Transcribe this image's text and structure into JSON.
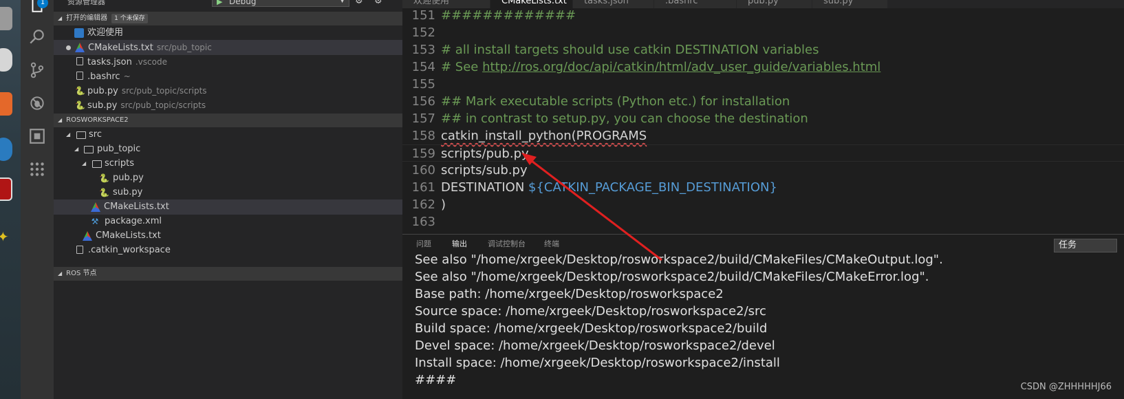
{
  "sidebar": {
    "title": "资源管理器",
    "debug_config": "Debug",
    "open_editors": {
      "header": "打开的编辑器",
      "unsaved_badge": "1 个未保存",
      "items": [
        {
          "label": "欢迎使用",
          "desc": ""
        },
        {
          "label": "CMakeLists.txt",
          "desc": "src/pub_topic"
        },
        {
          "label": "tasks.json",
          "desc": ".vscode"
        },
        {
          "label": ".bashrc",
          "desc": "~"
        },
        {
          "label": "pub.py",
          "desc": "src/pub_topic/scripts"
        },
        {
          "label": "sub.py",
          "desc": "src/pub_topic/scripts"
        }
      ]
    },
    "workspace": {
      "header": "ROSWORKSPACE2",
      "tree": [
        {
          "label": "src"
        },
        {
          "label": "pub_topic"
        },
        {
          "label": "scripts"
        },
        {
          "label": "pub.py"
        },
        {
          "label": "sub.py"
        },
        {
          "label": "CMakeLists.txt"
        },
        {
          "label": "package.xml"
        },
        {
          "label": "CMakeLists.txt"
        },
        {
          "label": ".catkin_workspace"
        }
      ]
    },
    "ros_nodes_header": "ROS 节点"
  },
  "activity": {
    "badge_count": "1"
  },
  "tabs": [
    "欢迎使用",
    "CMakeLists.txt",
    "tasks.json",
    ".bashrc",
    "pub.py",
    "sub.py"
  ],
  "editor": {
    "lines": [
      {
        "num": "151",
        "text": "#############"
      },
      {
        "num": "152",
        "text": ""
      },
      {
        "num": "153",
        "text": "# all install targets should use catkin DESTINATION variables"
      },
      {
        "num": "154",
        "prefix": "# See ",
        "link": "http://ros.org/doc/api/catkin/html/adv_user_guide/variables.html"
      },
      {
        "num": "155",
        "text": ""
      },
      {
        "num": "156",
        "text": "## Mark executable scripts (Python etc.) for installation"
      },
      {
        "num": "157",
        "text": "## in contrast to setup.py, you can choose the destination"
      },
      {
        "num": "158",
        "text": "catkin_install_python(PROGRAMS"
      },
      {
        "num": "159",
        "text": "scripts/pub.py"
      },
      {
        "num": "160",
        "text": "scripts/sub.py"
      },
      {
        "num": "161",
        "prefix": "DESTINATION ",
        "var": "${CATKIN_PACKAGE_BIN_DESTINATION}"
      },
      {
        "num": "162",
        "text": ")"
      },
      {
        "num": "163",
        "text": ""
      }
    ]
  },
  "panel": {
    "tabs": [
      "问题",
      "输出",
      "调试控制台",
      "终端"
    ],
    "task_select": "任务",
    "output": [
      "See also \"/home/xrgeek/Desktop/rosworkspace2/build/CMakeFiles/CMakeOutput.log\".",
      "See also \"/home/xrgeek/Desktop/rosworkspace2/build/CMakeFiles/CMakeError.log\".",
      "Base path: /home/xrgeek/Desktop/rosworkspace2",
      "Source space: /home/xrgeek/Desktop/rosworkspace2/src",
      "Build space: /home/xrgeek/Desktop/rosworkspace2/build",
      "Devel space: /home/xrgeek/Desktop/rosworkspace2/devel",
      "Install space: /home/xrgeek/Desktop/rosworkspace2/install",
      "####"
    ]
  },
  "watermark": "CSDN @ZHHHHHJ66",
  "colors": {
    "accent": "#007acc",
    "annotation_arrow": "#e02020",
    "comment": "#6a9955",
    "variable": "#569cd6"
  }
}
